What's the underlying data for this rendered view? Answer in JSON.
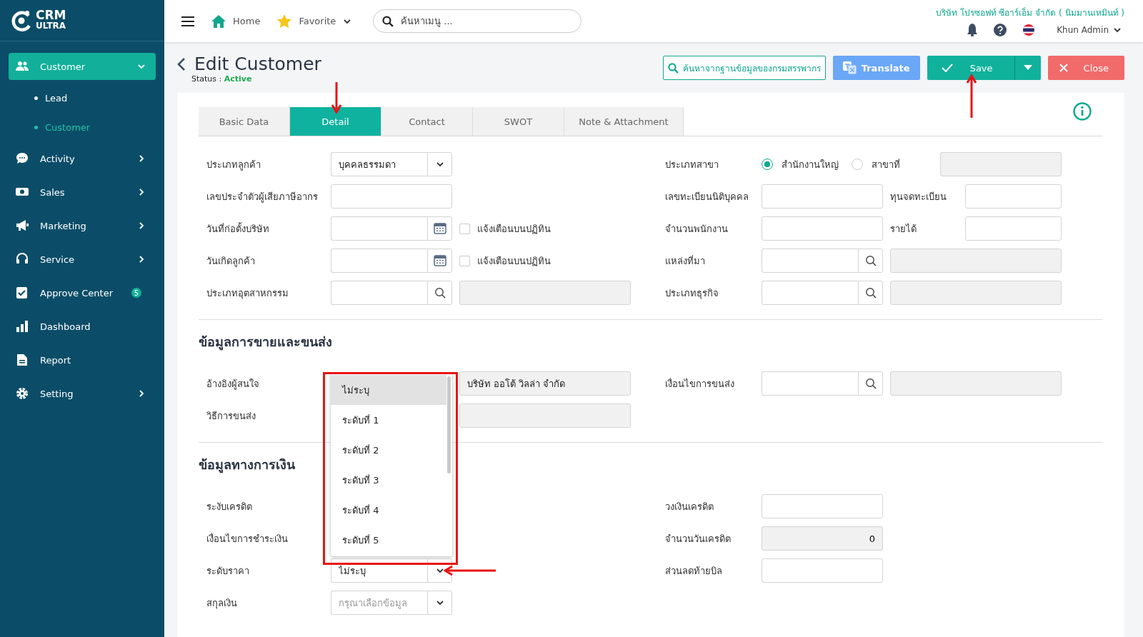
{
  "sidebar": {
    "logo": {
      "line1": "CRM",
      "line2": "ULTRA"
    },
    "items": [
      {
        "label": "Customer",
        "kind": "group",
        "expanded": true,
        "selected": true,
        "children": [
          {
            "label": "Lead",
            "selected": false
          },
          {
            "label": "Customer",
            "selected": true
          }
        ]
      },
      {
        "label": "Activity",
        "kind": "group",
        "expanded": false,
        "selected": false
      },
      {
        "label": "Sales",
        "kind": "group",
        "expanded": false,
        "selected": false
      },
      {
        "label": "Marketing",
        "kind": "group",
        "expanded": false,
        "selected": false
      },
      {
        "label": "Service",
        "kind": "group",
        "expanded": false,
        "selected": false
      },
      {
        "label": "Approve Center",
        "kind": "link",
        "badge": "5",
        "selected": false
      },
      {
        "label": "Dashboard",
        "kind": "link",
        "selected": false
      },
      {
        "label": "Report",
        "kind": "link",
        "selected": false
      },
      {
        "label": "Setting",
        "kind": "group",
        "expanded": false,
        "selected": false
      }
    ]
  },
  "topbar": {
    "home": "Home",
    "favorite": "Favorite",
    "search": {
      "placeholder": "ค้นหาเมนู ..."
    },
    "company": "บริษัท โปรซอฟท์ ซีอาร์เอ็ม จำกัด ( นิมมานเหมินท์ )",
    "user": "Khun Admin"
  },
  "page": {
    "title": "Edit Customer",
    "status_label": "Status :",
    "status": "Active"
  },
  "actions": {
    "lookup": "ค้นหาจากฐานข้อมูลของกรมสรรพากร",
    "translate": "Translate",
    "save": "Save",
    "save_callout": true,
    "close": "Close"
  },
  "tabs": [
    {
      "label": "Basic Data",
      "selected": false,
      "callout": false
    },
    {
      "label": "Detail",
      "selected": true,
      "callout": true
    },
    {
      "label": "Contact",
      "selected": false,
      "callout": false
    },
    {
      "label": "SWOT",
      "selected": false,
      "callout": false
    },
    {
      "label": "Note & Attachment",
      "selected": false,
      "callout": false
    }
  ],
  "sections": [
    {
      "rows": [
        {
          "left": {
            "label": "ประเภทลูกค้า",
            "kind": "select",
            "value": "บุคคลธรรมดา"
          },
          "right": {
            "label": "ประเภทสาขา",
            "kind": "radio",
            "options": [
              {
                "label": "สำนักงานใหญ่",
                "selected": true
              },
              {
                "label": "สาขาที่",
                "selected": false
              }
            ],
            "side": {
              "kind": "readonly"
            }
          }
        },
        {
          "left": {
            "label": "เลขประจำตัวผู้เสียภาษีอากร",
            "kind": "text"
          },
          "right": {
            "label": "เลขทะเบียนนิติบุคคล",
            "kind": "text",
            "pair": {
              "label": "ทุนจดทะเบียน",
              "kind": "text"
            }
          }
        },
        {
          "left": {
            "label": "วันที่ก่อตั้งบริษัท",
            "kind": "date",
            "side": {
              "kind": "checkbox",
              "label": "แจ้งเตือนบนปฏิทิน",
              "checked": false
            }
          },
          "right": {
            "label": "จำนวนพนักงาน",
            "kind": "text",
            "pair": {
              "label": "รายได้",
              "kind": "text"
            }
          }
        },
        {
          "left": {
            "label": "วันเกิดลูกค้า",
            "kind": "date",
            "side": {
              "kind": "checkbox",
              "label": "แจ้งเตือนบนปฏิทิน",
              "checked": false
            }
          },
          "right": {
            "label": "แหล่งที่มา",
            "kind": "lookup",
            "side": {
              "kind": "readonly"
            }
          }
        },
        {
          "left": {
            "label": "ประเภทอุตสาหกรรม",
            "kind": "lookup",
            "side": {
              "kind": "readonly"
            }
          },
          "right": {
            "label": "ประเภทธุรกิจ",
            "kind": "lookup",
            "side": {
              "kind": "readonly"
            }
          }
        }
      ]
    },
    {
      "title": "ข้อมูลการขายและขนส่ง",
      "rows": [
        {
          "left": {
            "label": "อ้างอิงผู้สนใจ",
            "kind": "covered",
            "side": {
              "kind": "readonly",
              "value": "บริษัท ออโต้ วิลล่า จำกัด"
            }
          },
          "right": {
            "label": "เงื่อนไขการขนส่ง",
            "kind": "lookup",
            "side": {
              "kind": "readonly"
            }
          }
        },
        {
          "left": {
            "label": "วิธีการขนส่ง",
            "kind": "covered",
            "side": {
              "kind": "readonly"
            }
          }
        }
      ]
    },
    {
      "title": "ข้อมูลทางการเงิน",
      "rows": [
        {
          "left": {
            "label": "ระงับเครดิต",
            "kind": "covered"
          },
          "right": {
            "label": "วงเงินเครดิต",
            "kind": "text"
          }
        },
        {
          "left": {
            "label": "เงื่อนไขการชำระเงิน",
            "kind": "covered"
          },
          "right": {
            "label": "จำนวนวันเครดิต",
            "kind": "readonly",
            "value": "0"
          }
        },
        {
          "left": {
            "label": "ระดับราคา",
            "kind": "select",
            "value": "ไม่ระบุ",
            "callout": true,
            "open": true,
            "options": [
              {
                "label": "ไม่ระบุ",
                "selected": true
              },
              {
                "label": "ระดับที่ 1",
                "selected": false
              },
              {
                "label": "ระดับที่ 2",
                "selected": false
              },
              {
                "label": "ระดับที่ 3",
                "selected": false
              },
              {
                "label": "ระดับที่ 4",
                "selected": false
              },
              {
                "label": "ระดับที่ 5",
                "selected": false
              }
            ]
          },
          "right": {
            "label": "ส่วนลดท้ายบิล",
            "kind": "text"
          }
        },
        {
          "left": {
            "label": "สกุลเงิน",
            "kind": "select",
            "placeholder": "กรุณาเลือกข้อมูล"
          }
        }
      ]
    }
  ]
}
